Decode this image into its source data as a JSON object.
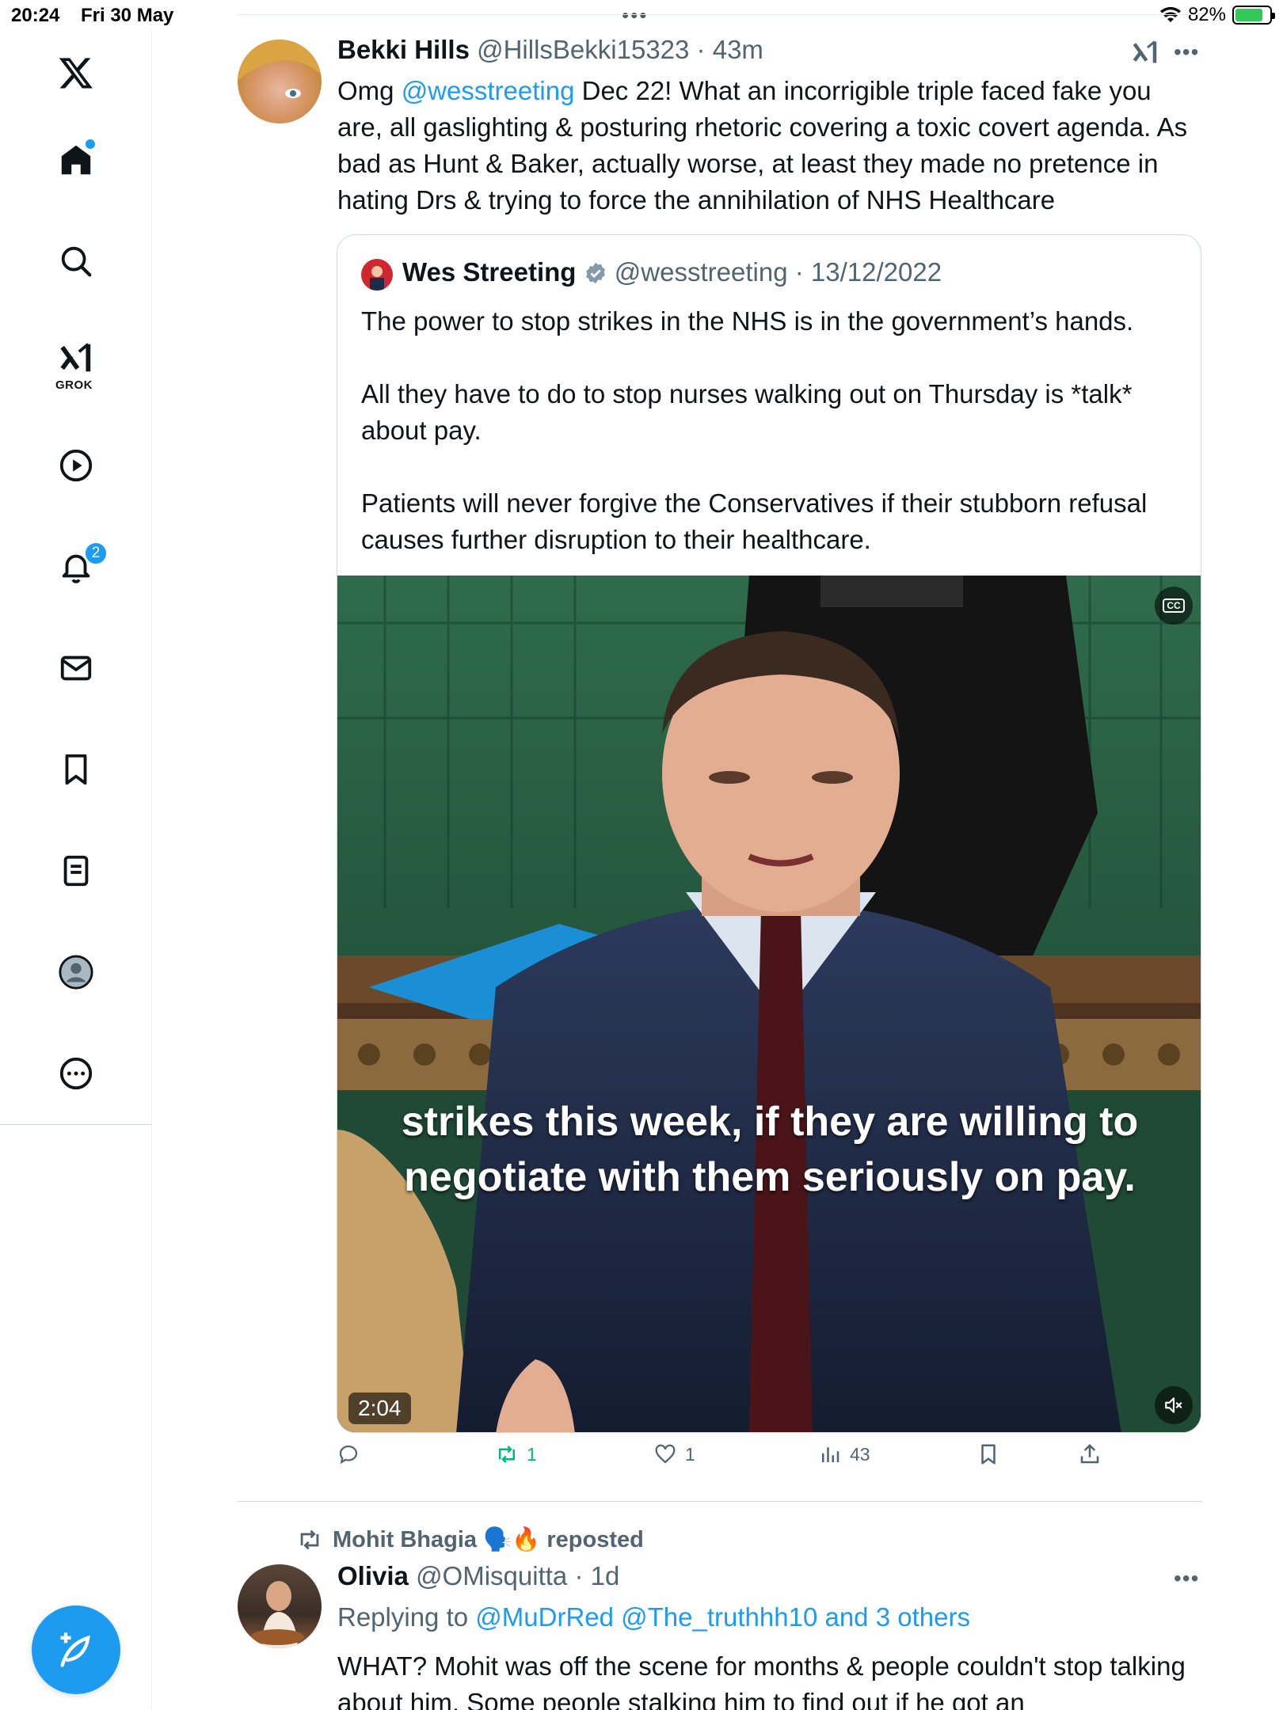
{
  "status_bar": {
    "time": "20:24",
    "date": "Fri 30 May",
    "battery": "82%"
  },
  "sidebar": {
    "items": [
      "home-icon",
      "search-icon",
      "grok-icon",
      "video-icon",
      "notifications-icon",
      "messages-icon",
      "bookmarks-icon",
      "lists-icon",
      "profile-icon",
      "more-icon"
    ],
    "grok_label": "GROK",
    "notifications_count": "2"
  },
  "tweet": {
    "author_name": "Bekki Hills",
    "author_handle": "@HillsBekki15323",
    "time": "43m",
    "text_prefix": "Omg ",
    "mention": "@wesstreeting",
    "text_rest": " Dec 22! What an incorrigible triple faced fake you are, all gaslighting & posturing rhetoric covering a toxic covert agenda. As bad as Hunt & Baker, actually worse, at least they made no pretence in hating Drs & trying to force the annihilation of NHS Healthcare",
    "quote": {
      "author_name": "Wes Streeting",
      "author_handle": "@wesstreeting",
      "date": "13/12/2022",
      "para1": "The power to stop strikes in the NHS is in the government’s hands.",
      "para2": "All they have to do to stop nurses walking out on Thursday is *talk* about pay.",
      "para3": "Patients will never forgive the Conservatives if their stubborn refusal causes further disruption to their healthcare.",
      "video": {
        "caption_line1": "strikes this week, if they are willing to",
        "caption_line2": "negotiate with them seriously on pay.",
        "duration": "2:04",
        "cc_label": "CC"
      }
    },
    "actions": {
      "reposts": "1",
      "likes": "1",
      "views": "43"
    },
    "colors": {
      "accent": "#1d9bf0",
      "repost_active": "#00ba7c"
    }
  },
  "next_tweet": {
    "reposted_by": "Mohit Bhagia 🗣️🔥 reposted",
    "author_name": "Olivia",
    "author_handle": "@OMisquitta",
    "time": "1d",
    "replying_label": "Replying to",
    "replying_handles": "@MuDrRed @The_truthhh10 and 3 others",
    "text": "WHAT? Mohit was off the scene for months & people couldn't stop talking about him. Some people stalking him to find out if he got an"
  }
}
